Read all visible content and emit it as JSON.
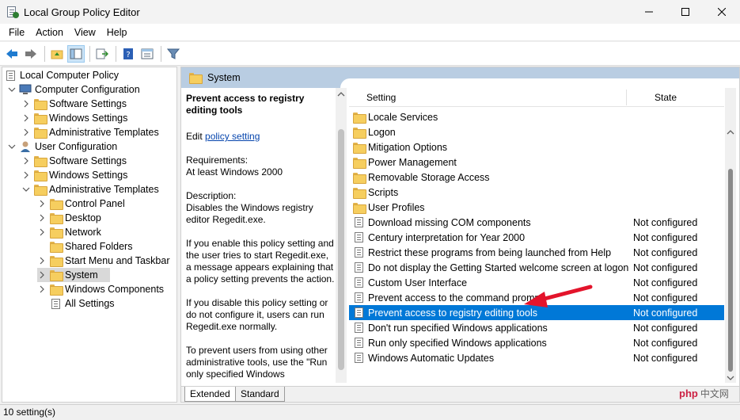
{
  "window": {
    "title": "Local Group Policy Editor",
    "controls": [
      "minimize-icon",
      "maximize-icon",
      "close-icon"
    ]
  },
  "menu": {
    "items": [
      "File",
      "Action",
      "View",
      "Help"
    ]
  },
  "toolbar": {
    "buttons": [
      "back-arrow-icon",
      "forward-arrow-icon",
      "up-folder-icon",
      "show-hide-tree-icon",
      "export-list-icon",
      "help-icon",
      "properties-icon",
      "filter-icon"
    ]
  },
  "tree": {
    "items": [
      {
        "label": "Local Computer Policy",
        "level": 0,
        "chev": "",
        "icon": "policy-root"
      },
      {
        "label": "Computer Configuration",
        "level": 1,
        "chev": "down",
        "icon": "computer"
      },
      {
        "label": "Software Settings",
        "level": 2,
        "chev": "right",
        "icon": "folder"
      },
      {
        "label": "Windows Settings",
        "level": 2,
        "chev": "right",
        "icon": "folder"
      },
      {
        "label": "Administrative Templates",
        "level": 2,
        "chev": "right",
        "icon": "folder"
      },
      {
        "label": "User Configuration",
        "level": 1,
        "chev": "down",
        "icon": "user"
      },
      {
        "label": "Software Settings",
        "level": 2,
        "chev": "right",
        "icon": "folder"
      },
      {
        "label": "Windows Settings",
        "level": 2,
        "chev": "right",
        "icon": "folder"
      },
      {
        "label": "Administrative Templates",
        "level": 2,
        "chev": "down",
        "icon": "folder"
      },
      {
        "label": "Control Panel",
        "level": 3,
        "chev": "right",
        "icon": "folder"
      },
      {
        "label": "Desktop",
        "level": 3,
        "chev": "right",
        "icon": "folder"
      },
      {
        "label": "Network",
        "level": 3,
        "chev": "right",
        "icon": "folder"
      },
      {
        "label": "Shared Folders",
        "level": 3,
        "chev": "",
        "icon": "folder"
      },
      {
        "label": "Start Menu and Taskbar",
        "level": 3,
        "chev": "right",
        "icon": "folder"
      },
      {
        "label": "System",
        "level": 3,
        "chev": "right",
        "icon": "folder",
        "selected": true
      },
      {
        "label": "Windows Components",
        "level": 3,
        "chev": "right",
        "icon": "folder"
      },
      {
        "label": "All Settings",
        "level": 3,
        "chev": "",
        "icon": "settings"
      }
    ]
  },
  "banner": {
    "label": "System"
  },
  "description": {
    "heading": "Prevent access to registry editing tools",
    "edit_prefix": "Edit ",
    "edit_link": "policy setting",
    "requirements": [
      "Requirements:",
      "At least Windows 2000"
    ],
    "desc_title": "Description:",
    "desc_body": "Disables the Windows registry editor Regedit.exe.",
    "para1": "If you enable this policy setting and the user tries to start Regedit.exe, a message appears explaining that a policy setting prevents the action.",
    "para2": "If you disable this policy setting or do not configure it, users can run Regedit.exe normally.",
    "para3": "To prevent users from using other administrative tools, use the \"Run only specified Windows"
  },
  "list": {
    "columns": {
      "setting": "Setting",
      "state": "State"
    },
    "rows": [
      {
        "name": "Locale Services",
        "state": "",
        "type": "folder"
      },
      {
        "name": "Logon",
        "state": "",
        "type": "folder"
      },
      {
        "name": "Mitigation Options",
        "state": "",
        "type": "folder"
      },
      {
        "name": "Power Management",
        "state": "",
        "type": "folder"
      },
      {
        "name": "Removable Storage Access",
        "state": "",
        "type": "folder"
      },
      {
        "name": "Scripts",
        "state": "",
        "type": "folder"
      },
      {
        "name": "User Profiles",
        "state": "",
        "type": "folder"
      },
      {
        "name": "Download missing COM components",
        "state": "Not configured",
        "type": "policy"
      },
      {
        "name": "Century interpretation for Year 2000",
        "state": "Not configured",
        "type": "policy"
      },
      {
        "name": "Restrict these programs from being launched from Help",
        "state": "Not configured",
        "type": "policy"
      },
      {
        "name": "Do not display the Getting Started welcome screen at logon",
        "state": "Not configured",
        "type": "policy"
      },
      {
        "name": "Custom User Interface",
        "state": "Not configured",
        "type": "policy"
      },
      {
        "name": "Prevent access to the command prompt",
        "state": "Not configured",
        "type": "policy"
      },
      {
        "name": "Prevent access to registry editing tools",
        "state": "Not configured",
        "type": "policy",
        "selected": true
      },
      {
        "name": "Don't run specified Windows applications",
        "state": "Not configured",
        "type": "policy"
      },
      {
        "name": "Run only specified Windows applications",
        "state": "Not configured",
        "type": "policy"
      },
      {
        "name": "Windows Automatic Updates",
        "state": "Not configured",
        "type": "policy"
      }
    ]
  },
  "tabs": {
    "extended": "Extended",
    "standard": "Standard"
  },
  "status": {
    "text": "10 setting(s)"
  },
  "watermark": {
    "brand": "php",
    "cn": "中文网"
  },
  "colors": {
    "selection": "#0078d7",
    "banner": "#b9cde2",
    "arrow": "#e3142b",
    "link": "#0645ad"
  }
}
